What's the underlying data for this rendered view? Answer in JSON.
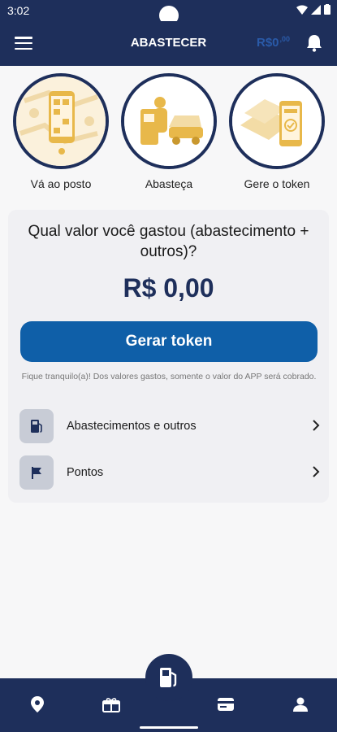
{
  "status": {
    "time": "3:02"
  },
  "header": {
    "title": "ABASTECER",
    "balance_main": "R$0",
    "balance_cents": ",00"
  },
  "steps": [
    {
      "label": "Vá ao posto",
      "icon": "map-phone-illustration"
    },
    {
      "label": "Abasteça",
      "icon": "fuel-pump-car-illustration"
    },
    {
      "label": "Gere o token",
      "icon": "phone-token-illustration"
    }
  ],
  "main": {
    "question": "Qual valor você gastou (abastecimento + outros)?",
    "amount": "R$ 0,00",
    "button_label": "Gerar token",
    "hint": "Fique tranquilo(a)! Dos valores gastos, somente o valor do APP será cobrado.",
    "items": [
      {
        "label": "Abastecimentos e outros",
        "icon": "fuel-pump-icon"
      },
      {
        "label": "Pontos",
        "icon": "flag-icon"
      }
    ]
  },
  "nav": [
    "location-icon",
    "gift-icon",
    "fuel-pump-icon",
    "card-icon",
    "user-icon"
  ],
  "colors": {
    "primary": "#1e2f5b",
    "accent": "#0f5fa8",
    "illustration": "#e8b84a"
  }
}
